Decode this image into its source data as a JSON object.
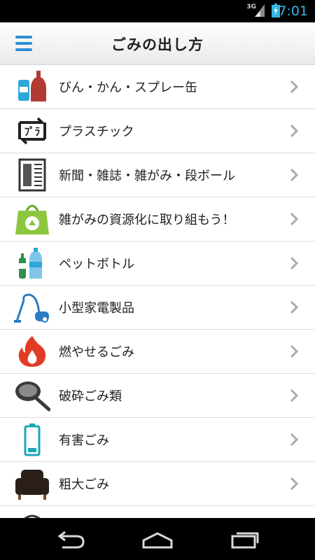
{
  "status_bar": {
    "network": "3G",
    "time": "7:01"
  },
  "app_bar": {
    "title": "ごみの出し方"
  },
  "items": [
    {
      "label": "びん・かん・スプレー缶",
      "icon": "bottle-can-icon"
    },
    {
      "label": "プラスチック",
      "icon": "plastic-recycle-icon"
    },
    {
      "label": "新聞・雑誌・雑がみ・段ボール",
      "icon": "newspaper-icon"
    },
    {
      "label": "雑がみの資源化に取り組もう！",
      "icon": "recycle-bag-icon"
    },
    {
      "label": "ペットボトル",
      "icon": "pet-bottle-icon"
    },
    {
      "label": "小型家電製品",
      "icon": "vacuum-cleaner-icon"
    },
    {
      "label": "燃やせるごみ",
      "icon": "fire-icon"
    },
    {
      "label": "破砕ごみ類",
      "icon": "frying-pan-icon"
    },
    {
      "label": "有害ごみ",
      "icon": "battery-icon"
    },
    {
      "label": "粗大ごみ",
      "icon": "sofa-icon"
    }
  ],
  "colors": {
    "accent": "#2b8fd3",
    "status_text": "#33b5e5"
  }
}
